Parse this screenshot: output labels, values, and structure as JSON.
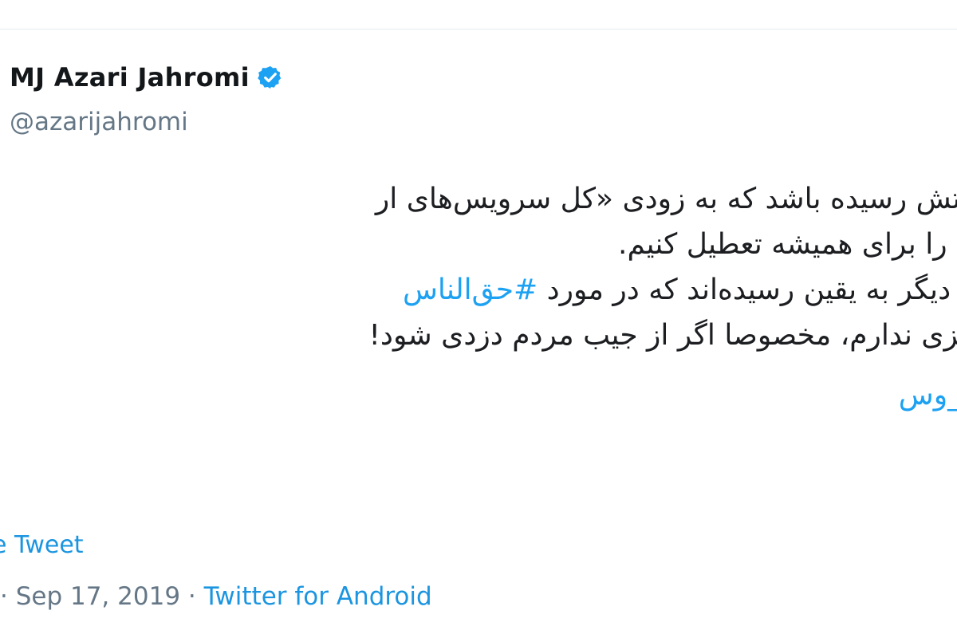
{
  "author": {
    "display_name": "MJ Azari Jahromi",
    "handle": "@azarijahromi"
  },
  "tweet": {
    "lines": [
      "وقتش رسیده باشد که به زودی «کل سرویس‌های ار",
      "ه» را برای همیشه تعطیل کنیم.",
      "ان دیگر به یقین رسیده‌اند که در مورد",
      "#حق‌الناس",
      "رمزی ندارم، مخصوصا اگر از جیب مردم دزدی شود!",
      "ت_وس"
    ]
  },
  "see_tweet_label": "e Tweet",
  "meta": {
    "date_text": "· Sep 17, 2019 ·",
    "source": "Twitter for Android"
  },
  "colors": {
    "link": "#1b95e0",
    "hashtag": "#1da1f2",
    "secondary_text": "#657786",
    "verified_badge": "#1da1f2"
  }
}
